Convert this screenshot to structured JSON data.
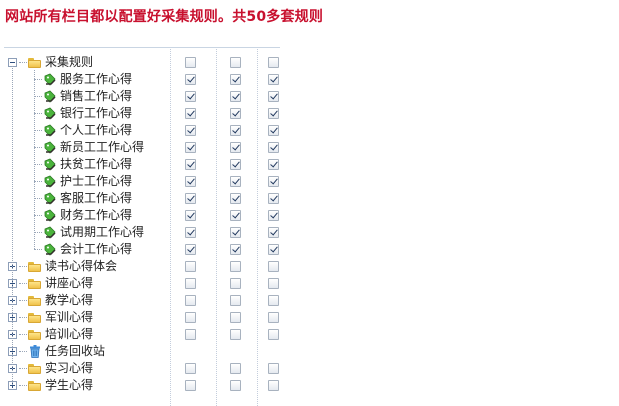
{
  "heading": "网站所有栏目都以配置好采集规则。共50多套规则",
  "colors": {
    "heading": "#c8102e",
    "check": "#22395e"
  },
  "tree": {
    "root": {
      "label": "采集规则",
      "expanded": true,
      "checks": [
        false,
        false,
        false
      ],
      "children": [
        {
          "label": "服务工作心得",
          "checks": [
            true,
            true,
            true
          ]
        },
        {
          "label": "销售工作心得",
          "checks": [
            true,
            true,
            true
          ]
        },
        {
          "label": "银行工作心得",
          "checks": [
            true,
            true,
            true
          ]
        },
        {
          "label": "个人工作心得",
          "checks": [
            true,
            true,
            true
          ]
        },
        {
          "label": "新员工工作心得",
          "checks": [
            true,
            true,
            true
          ]
        },
        {
          "label": "扶贫工作心得",
          "checks": [
            true,
            true,
            true
          ]
        },
        {
          "label": "护士工作心得",
          "checks": [
            true,
            true,
            true
          ]
        },
        {
          "label": "客服工作心得",
          "checks": [
            true,
            true,
            true
          ]
        },
        {
          "label": "财务工作心得",
          "checks": [
            true,
            true,
            true
          ]
        },
        {
          "label": "试用期工作心得",
          "checks": [
            true,
            true,
            true
          ]
        },
        {
          "label": "会计工作心得",
          "checks": [
            true,
            true,
            true
          ]
        }
      ]
    },
    "folders": [
      {
        "label": "读书心得体会",
        "icon": "folder-icon",
        "checks": [
          false,
          false,
          false
        ]
      },
      {
        "label": "讲座心得",
        "icon": "folder-icon",
        "checks": [
          false,
          false,
          false
        ]
      },
      {
        "label": "教学心得",
        "icon": "folder-icon",
        "checks": [
          false,
          false,
          false
        ]
      },
      {
        "label": "军训心得",
        "icon": "folder-icon",
        "checks": [
          false,
          false,
          false
        ]
      },
      {
        "label": "培训心得",
        "icon": "folder-icon",
        "checks": [
          false,
          false,
          false
        ]
      },
      {
        "label": "任务回收站",
        "icon": "recycle-bin-icon",
        "checks": []
      },
      {
        "label": "实习心得",
        "icon": "folder-icon",
        "checks": [
          false,
          false,
          false
        ]
      },
      {
        "label": "学生心得",
        "icon": "folder-icon",
        "checks": [
          false,
          false,
          false
        ]
      }
    ]
  }
}
